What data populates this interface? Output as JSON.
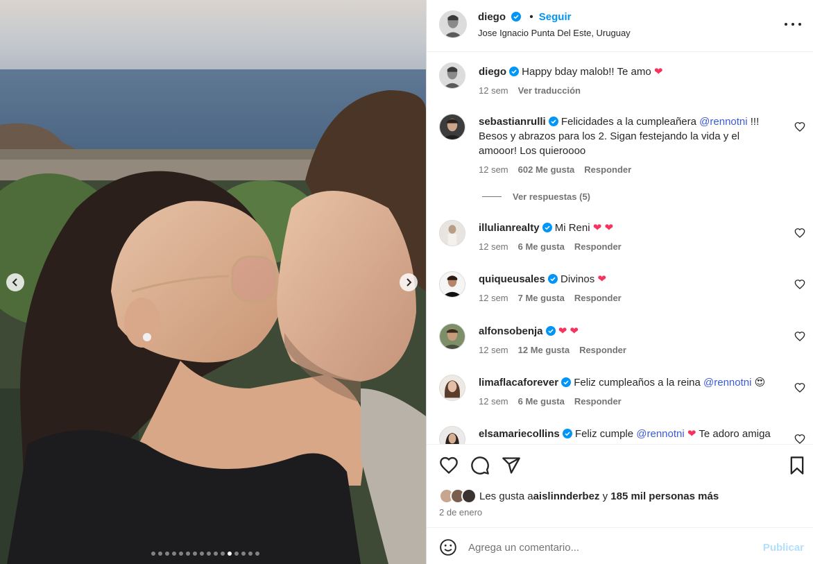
{
  "post": {
    "username": "diego",
    "follow_label": "Seguir",
    "separator": "•",
    "location": "Jose Ignacio Punta Del Este, Uruguay",
    "more_icon": "more-horizontal-icon"
  },
  "carousel": {
    "total_slides": 16,
    "active_slide": 12
  },
  "comments": [
    {
      "username": "diego",
      "text": "Happy bday malob!! Te amo ",
      "heart": "❤",
      "time": "12 sem",
      "action": "Ver traducción"
    },
    {
      "username": "sebastianrulli",
      "text_before": "Felicidades a la cumpleañera ",
      "mention": "@rennotni",
      "text_after": " !!! Besos y abrazos para los 2. Sigan festejando la vida y el amooor! Los quieroooo",
      "time": "12 sem",
      "likes": "602 Me gusta",
      "reply": "Responder",
      "view_replies": "Ver respuestas (5)"
    },
    {
      "username": "illulianrealty",
      "text": "Mi Reni ",
      "heart": "❤ ❤",
      "time": "12 sem",
      "likes": "6 Me gusta",
      "reply": "Responder"
    },
    {
      "username": "quiqueusales",
      "text": "Divinos ",
      "heart": "❤",
      "time": "12 sem",
      "likes": "7 Me gusta",
      "reply": "Responder"
    },
    {
      "username": "alfonsobenja",
      "text": "",
      "heart": "❤ ❤",
      "time": "12 sem",
      "likes": "12 Me gusta",
      "reply": "Responder"
    },
    {
      "username": "limaflacaforever",
      "text_before": "Feliz cumpleaños a la reina ",
      "mention": "@rennotni",
      "emoji": "😍",
      "time": "12 sem",
      "likes": "6 Me gusta",
      "reply": "Responder"
    },
    {
      "username": "elsamariecollins",
      "text_before": "Feliz cumple ",
      "mention": "@rennotni",
      "heart": "❤",
      "text_after": "Te adoro amiga"
    }
  ],
  "likes_summary": {
    "prefix": "Les gusta a ",
    "user": "aislinnderbez",
    "middle": " y ",
    "count": "185 mil personas más"
  },
  "date": "2 de enero",
  "add_comment": {
    "placeholder": "Agrega un comentario...",
    "publish_label": "Publicar"
  },
  "colors": {
    "accent_blue": "#0095f6",
    "mention": "#3a5ad9",
    "heart": "#f6335e",
    "publish_disabled": "#b2dffc"
  }
}
